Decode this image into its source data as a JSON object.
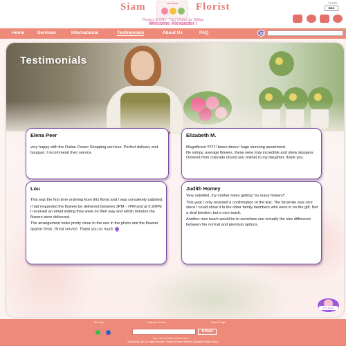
{
  "header": {
    "brand_left": "Siam",
    "brand_right": "Florist",
    "logo_text": "Siam Florist",
    "tagline": "Flowers & Gifts : Your Choice for Gifting",
    "welcome": "Welcome Alexander !",
    "language_label": "Language",
    "language_value": "ENG",
    "icons": [
      "cart-icon",
      "gift-icon",
      "basket-icon",
      "favorite-icon"
    ]
  },
  "nav": {
    "items": [
      {
        "label": "Home"
      },
      {
        "label": "Services"
      },
      {
        "label": "International"
      },
      {
        "label": "Testimonials",
        "active": true
      },
      {
        "label": "About Us"
      },
      {
        "label": "FAQ"
      }
    ],
    "search_placeholder": ""
  },
  "page": {
    "title": "Testimonials"
  },
  "testimonials": [
    {
      "name": "Elena Peer",
      "paragraphs": [
        "very happy with the Online Flower Shopping services. Perfect delivery and bouquet. I recommend their service."
      ]
    },
    {
      "name": "Elizabeth M.",
      "paragraphs": [
        "Magnificent !!!!!!!!! bravo-bravo! huge stunning assortment.",
        "No wimpy, average flowers, these were truly incredible and show stoppers. Ordered from colorado (found you online) to my daughter, thank you."
      ]
    },
    {
      "name": "Lou",
      "paragraphs": [
        "This was the first time ordering from this florist and I was completely satisfied.",
        "I had requested the flowers be delivered between 3PM - 7PM and at 5:20PM I received an email stating they were on their way and within minutes the flowers were delivered.",
        "The arrangement looks pretty close to the one in the photo and the flowers appear fresh. Great service. Thank you so much"
      ]
    },
    {
      "name": "Judith Homey",
      "paragraphs": [
        "Very satisfied, my mother loves getting \"so many flowers!\".",
        "This year I only received a confirmation of the text. The facsimile was nice since I could show it to the other family members who were in on the gift. Not a deal breaker, but a nice touch.",
        "Another nice touch would be to somehow see virtually the size difference between the normal and premium options."
      ]
    }
  ],
  "badge_label": "Love Florist",
  "footer": {
    "links": [
      "Site Map",
      "Customer Service",
      "View All Tags"
    ],
    "email_label": "Type Your Email to Subscribe",
    "email_button": "Email",
    "copyright": "SiamFlorist.com. All rights reserved. Thailand Flowers Delivery | Bangkok Flower Shop |"
  },
  "colors": {
    "nav_bg": "#ee8a79",
    "brand": "#e07a72",
    "card_border": "#7e4ea6",
    "accent_purple": "#9a5fd1"
  }
}
